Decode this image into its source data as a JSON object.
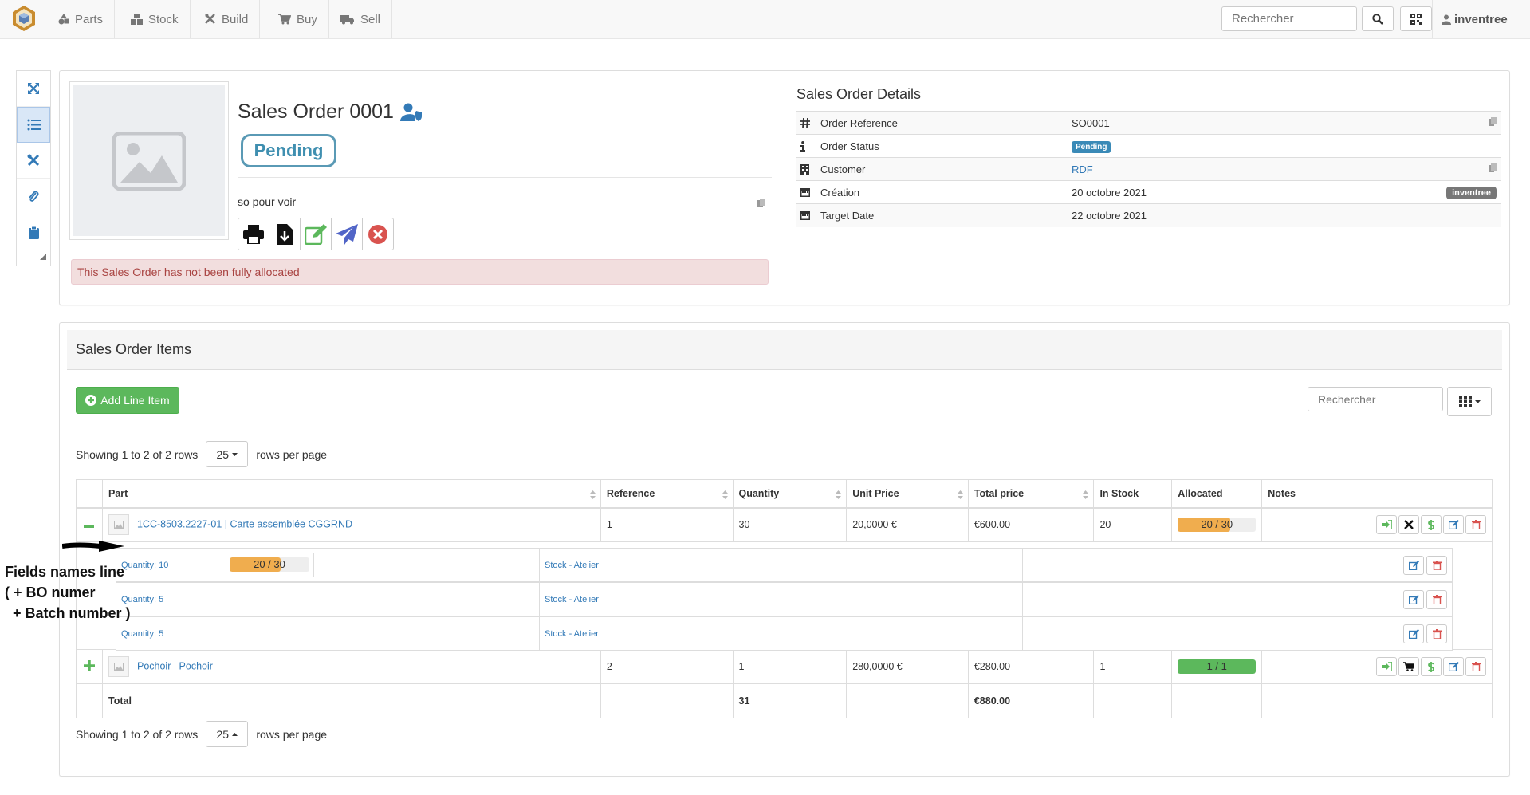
{
  "navbar": {
    "items": [
      {
        "label": "Parts",
        "icon": "shapes-icon"
      },
      {
        "label": "Stock",
        "icon": "boxes-icon"
      },
      {
        "label": "Build",
        "icon": "tools-icon"
      },
      {
        "label": "Buy",
        "icon": "cart-icon"
      },
      {
        "label": "Sell",
        "icon": "truck-icon"
      }
    ],
    "search_placeholder": "Rechercher",
    "user": "inventree"
  },
  "order": {
    "title": "Sales Order 0001",
    "status": "Pending",
    "description": "so pour voir",
    "alert": "This Sales Order has not been fully allocated"
  },
  "details": {
    "title": "Sales Order Details",
    "rows": [
      {
        "icon": "hash-icon",
        "label": "Order Reference",
        "value": "SO0001"
      },
      {
        "icon": "info-icon",
        "label": "Order Status",
        "value": "Pending"
      },
      {
        "icon": "building-icon",
        "label": "Customer",
        "value": "RDF"
      },
      {
        "icon": "calendar-icon",
        "label": "Création",
        "value": "20 octobre 2021",
        "badge": "inventree"
      },
      {
        "icon": "calendar-icon",
        "label": "Target Date",
        "value": "22 octobre 2021"
      }
    ]
  },
  "items_panel": {
    "title": "Sales Order Items",
    "add_button": "Add Line Item",
    "search_placeholder": "Rechercher",
    "pager_text": "Showing 1 to 2 of 2 rows",
    "page_size": "25",
    "rows_per_page": "rows per page"
  },
  "table": {
    "columns": [
      "Part",
      "Reference",
      "Quantity",
      "Unit Price",
      "Total price",
      "In Stock",
      "Allocated",
      "Notes"
    ],
    "rows": [
      {
        "expander": "−",
        "part": "1CC-8503.2227-01 | Carte assemblée CGGRND",
        "reference": "1",
        "quantity": "30",
        "unit_price": "20,0000 €",
        "total_price": "€600.00",
        "in_stock": "20",
        "allocated": "20 / 30",
        "allocated_fraction": 0.667,
        "allocated_color": "#f0ad4e"
      },
      {
        "expander": "+",
        "part": "Pochoir | Pochoir",
        "reference": "2",
        "quantity": "1",
        "unit_price": "280,0000 €",
        "total_price": "€280.00",
        "in_stock": "1",
        "allocated": "1 / 1",
        "allocated_fraction": 1.0,
        "allocated_color": "#5cb85c"
      }
    ],
    "sub_rows": [
      {
        "quantity": "Quantity: 10",
        "allocated": "20 / 30",
        "location": "Stock - Atelier"
      },
      {
        "quantity": "Quantity: 5",
        "location": "Stock - Atelier"
      },
      {
        "quantity": "Quantity: 5",
        "location": "Stock - Atelier"
      }
    ],
    "total": {
      "label": "Total",
      "quantity": "31",
      "total_price": "€880.00"
    }
  },
  "annotation": {
    "line1": "Fields names line",
    "line2": "( + BO numer",
    "line3": "+ Batch number )"
  }
}
